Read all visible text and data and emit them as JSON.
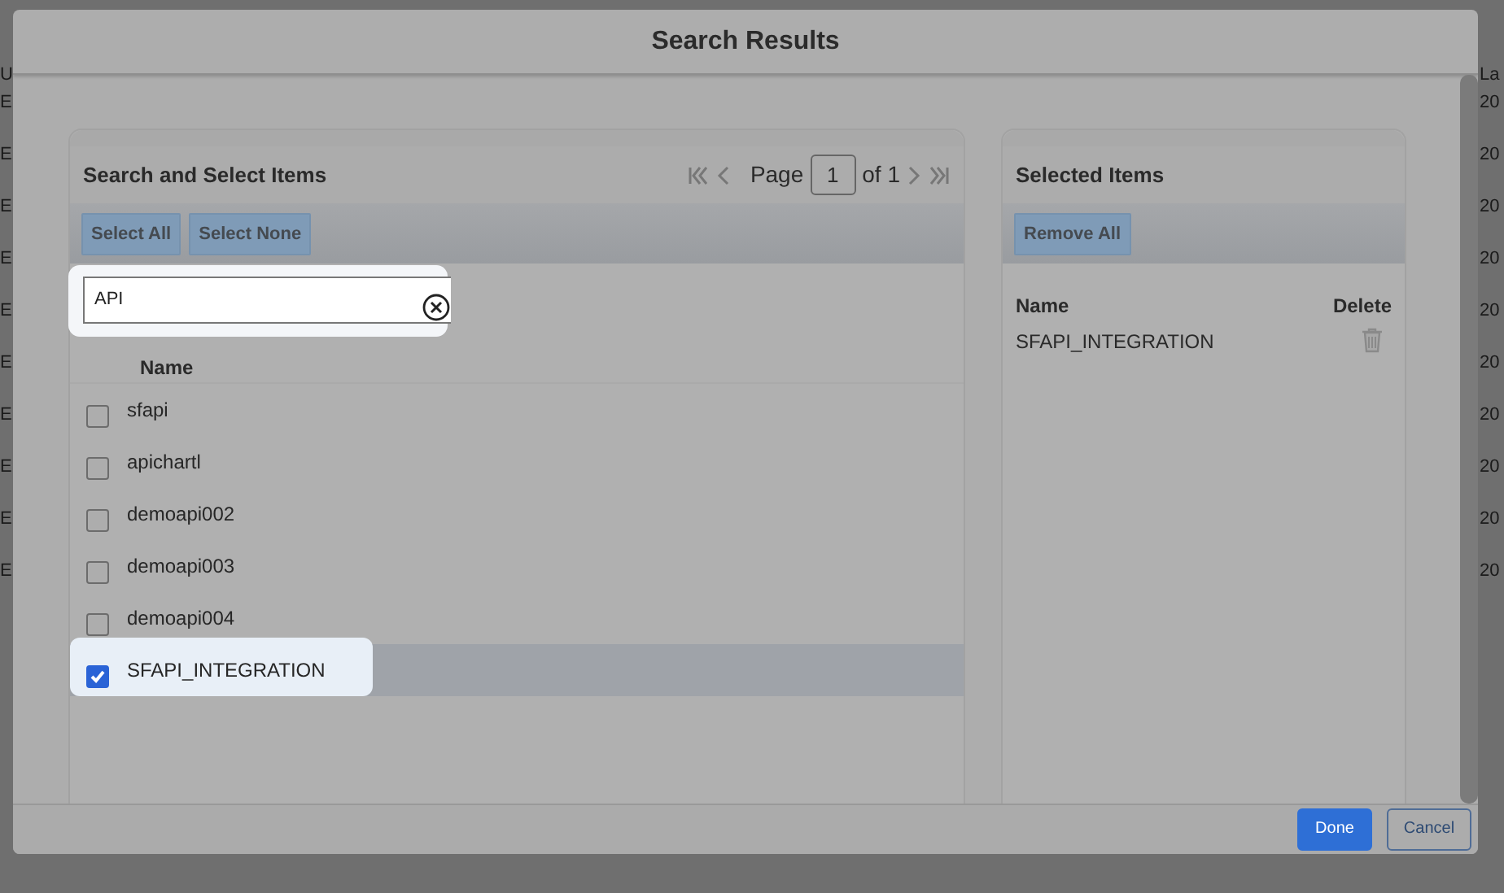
{
  "background": {
    "left_column": {
      "heading": "U",
      "cells": [
        "E",
        "E",
        "E",
        "E",
        "E",
        "E",
        "E",
        "E",
        "E",
        "E"
      ]
    },
    "right_column": {
      "heading": "La",
      "cells": [
        "20",
        "20",
        "20",
        "20",
        "20",
        "20",
        "20",
        "20",
        "20",
        "20"
      ]
    }
  },
  "dialog": {
    "title": "Search Results"
  },
  "search_panel": {
    "title": "Search and Select Items",
    "pager": {
      "label": "Page",
      "page": "1",
      "of": "of 1"
    },
    "buttons": [
      "Select All",
      "Select None"
    ],
    "search": {
      "value": "API",
      "highlighted": true
    },
    "column": "Name",
    "rows": [
      {
        "name": "sfapi",
        "checked": false,
        "selected": false,
        "highlighted": false
      },
      {
        "name": "apichartl",
        "checked": false,
        "selected": false,
        "highlighted": false
      },
      {
        "name": "demoapi002",
        "checked": false,
        "selected": false,
        "highlighted": false
      },
      {
        "name": "demoapi003",
        "checked": false,
        "selected": false,
        "highlighted": false
      },
      {
        "name": "demoapi004",
        "checked": false,
        "selected": false,
        "highlighted": false
      },
      {
        "name": "SFAPI_INTEGRATION",
        "checked": true,
        "selected": true,
        "highlighted": true
      }
    ]
  },
  "selected_panel": {
    "title": "Selected Items",
    "buttons": [
      "Remove All"
    ],
    "columns": [
      "Name",
      "Delete"
    ],
    "rows": [
      {
        "name": "SFAPI_INTEGRATION"
      }
    ]
  },
  "footer": {
    "buttons": [
      {
        "label": "Done",
        "kind": "primary"
      },
      {
        "label": "Cancel",
        "kind": "secondary"
      }
    ]
  }
}
